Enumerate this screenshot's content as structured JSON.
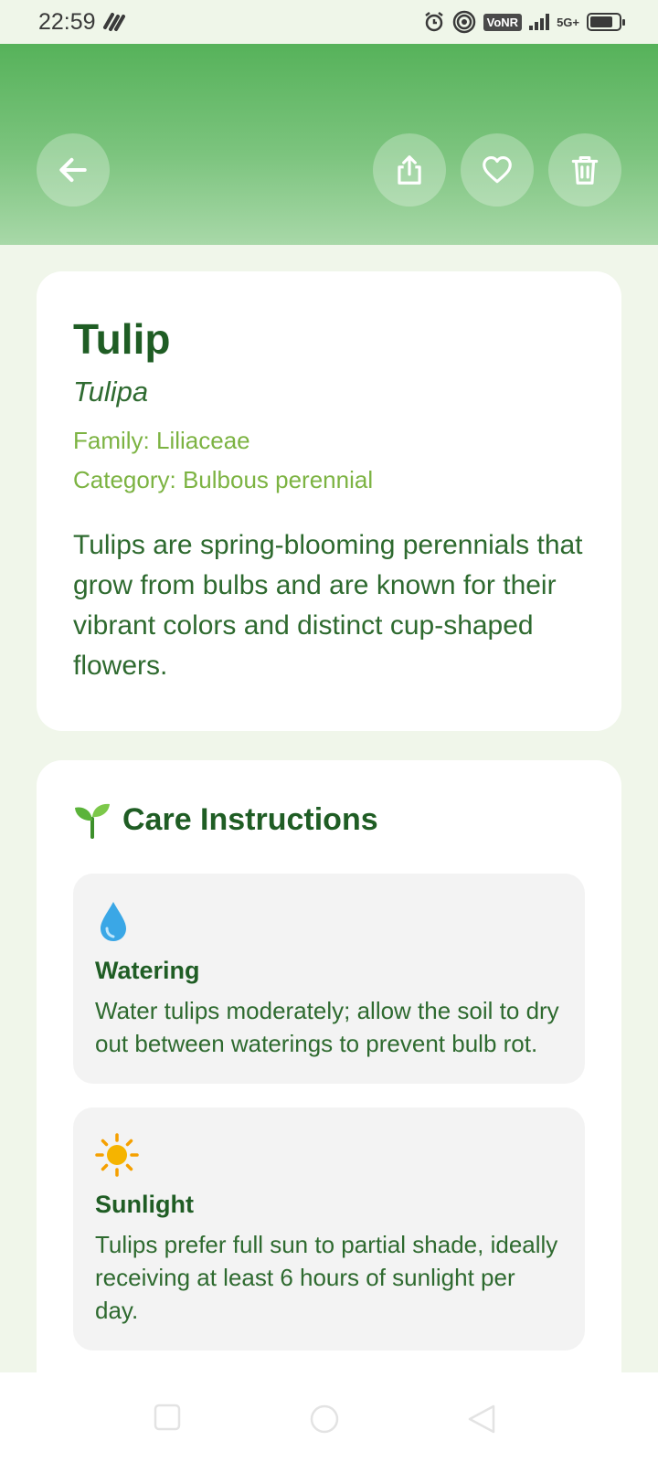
{
  "status_bar": {
    "time": "22:59",
    "vonr_label": "VoNR",
    "network_label": "5G+",
    "battery_level": 0.8,
    "icons": [
      "gesture-icon",
      "alarm-icon",
      "hotspot-icon",
      "signal-icon",
      "battery-icon"
    ]
  },
  "header": {
    "back_icon": "arrow-left-icon",
    "actions": [
      "share-icon",
      "heart-icon",
      "trash-icon"
    ],
    "accent_color": "#56b25a"
  },
  "plant": {
    "name": "Tulip",
    "scientific_name": "Tulipa",
    "family": "Family: Liliaceae",
    "category": "Category: Bulbous perennial",
    "description": "Tulips are spring-blooming perennials that grow from bulbs and are known for their vibrant colors and distinct cup-shaped flowers."
  },
  "care": {
    "icon": "seedling-icon",
    "title": "Care Instructions",
    "items": [
      {
        "icon": "water-drop-icon",
        "title": "Watering",
        "text": "Water tulips moderately; allow the soil to dry out between waterings to prevent bulb rot."
      },
      {
        "icon": "sun-icon",
        "title": "Sunlight",
        "text": "Tulips prefer full sun to partial shade, ideally receiving at least 6 hours of sunlight per day."
      }
    ]
  },
  "colors": {
    "title_green": "#1f5d24",
    "meta_green": "#7cb342",
    "background": "#f0f6ea"
  }
}
